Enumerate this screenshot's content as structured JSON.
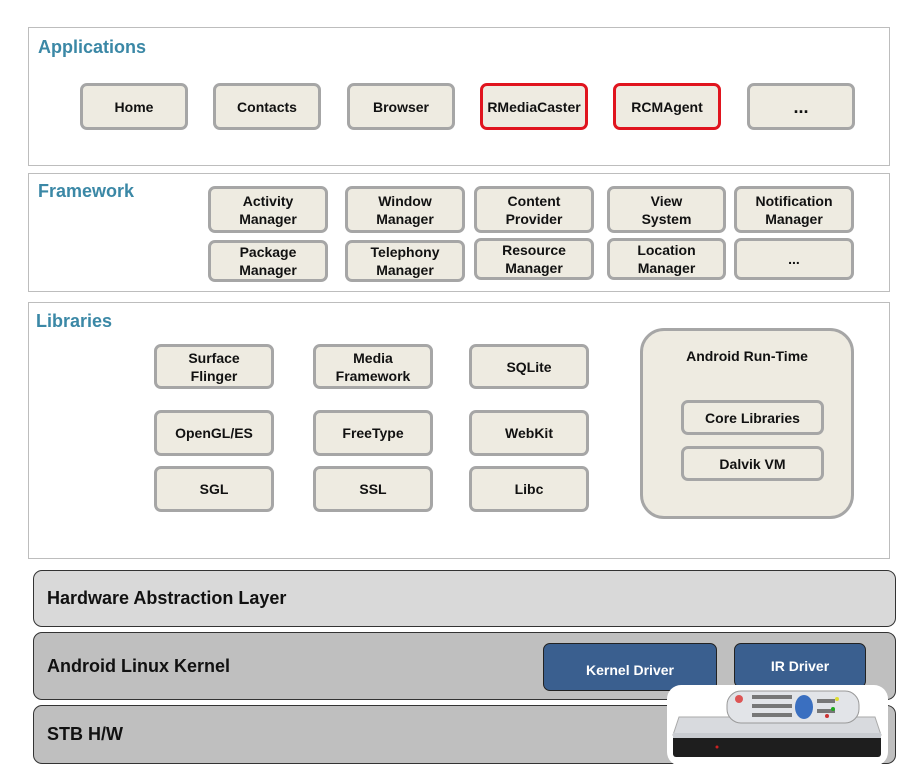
{
  "applications": {
    "title": "Applications",
    "items": [
      "Home",
      "Contacts",
      "Browser",
      "RMediaCaster",
      "RCMAgent",
      "..."
    ],
    "highlighted": [
      "RMediaCaster",
      "RCMAgent"
    ]
  },
  "framework": {
    "title": "Framework",
    "items": [
      "Activity\nManager",
      "Window\nManager",
      "Content\nProvider",
      "View\nSystem",
      "Notification\nManager",
      "Package\nManager",
      "Telephony\nManager",
      "Resource\nManager",
      "Location\nManager",
      "..."
    ]
  },
  "libraries": {
    "title": "Libraries",
    "items": [
      "Surface\nFlinger",
      "Media\nFramework",
      "SQLite",
      "OpenGL/ES",
      "FreeType",
      "WebKit",
      "SGL",
      "SSL",
      "Libc"
    ],
    "runtime": {
      "title": "Android Run-Time",
      "items": [
        "Core Libraries",
        "Dalvik VM"
      ]
    }
  },
  "hal": {
    "title": "Hardware Abstraction Layer"
  },
  "kernel": {
    "title": "Android Linux Kernel",
    "drivers": [
      "Kernel Driver",
      "IR Driver"
    ]
  },
  "stb": {
    "title": "STB H/W",
    "image": "set-top-box-with-remote"
  },
  "colors": {
    "title": "#3b88a6",
    "highlight": "#e0141e",
    "driver": "#3a5f8f"
  }
}
